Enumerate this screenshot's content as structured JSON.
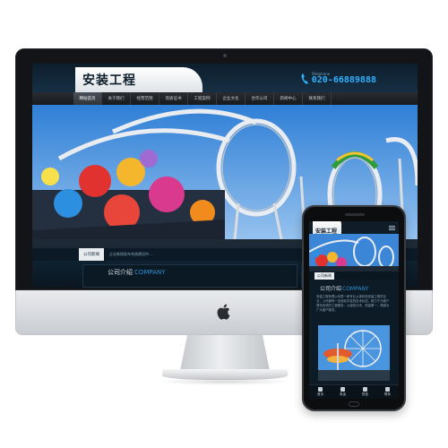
{
  "desktop_site": {
    "logo": "安装工程",
    "phone_caption": "Telephone",
    "phone_number": "020-66889888",
    "nav": [
      "网站首页",
      "关于我们",
      "经营范围",
      "资质证书",
      "工程案例",
      "企业文化",
      "合作公司",
      "新闻中心",
      "联系我们"
    ],
    "notice_tag": "公司新闻",
    "notice_text": "企业新闻发布系统建设中…",
    "section_title": "公司介绍",
    "section_title_en": "COMPANY"
  },
  "mobile_site": {
    "logo": "安装工程",
    "notice_tag": "公司新闻",
    "section_title": "公司介绍",
    "section_title_en": "COMPANY",
    "body_text": "安装工程有限公司是一家专业从事机电安装工程的企业，公司拥有一支经验丰富的技术队伍，致力于为客户提供优质的工程服务，以诚信为本，质量第一，竭诚为广大客户服务。",
    "tabs": [
      "首页",
      "电话",
      "短信",
      "联系"
    ]
  },
  "colors": {
    "accent": "#2fb2ff",
    "header_dark": "#0d1b27",
    "english_title": "#2e8fcf"
  }
}
